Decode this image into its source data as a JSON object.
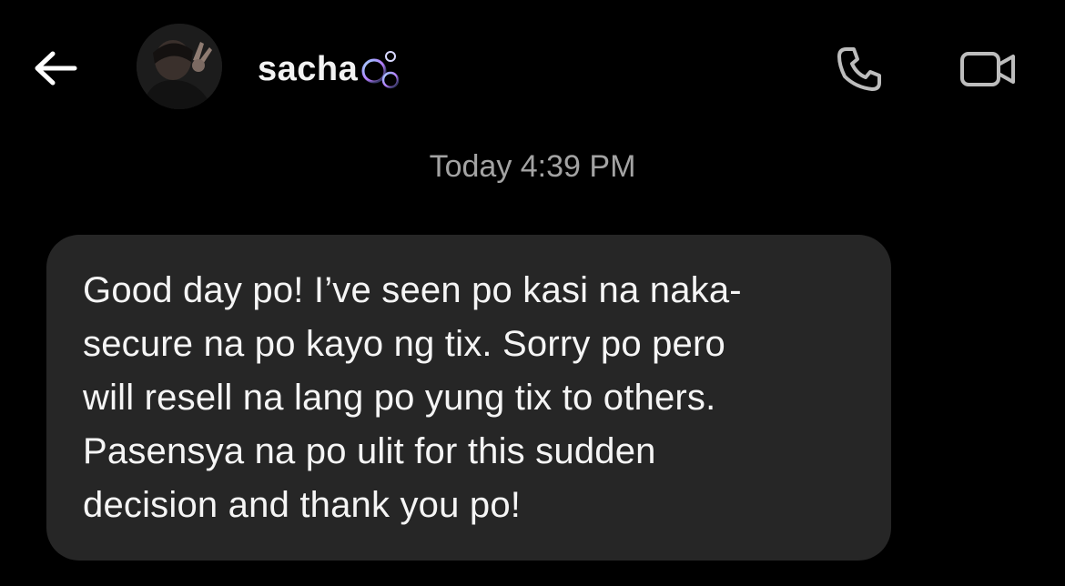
{
  "header": {
    "contact_name": "sacha",
    "back_icon": "arrow-left-icon",
    "call_icon": "phone-icon",
    "video_icon": "video-camera-icon",
    "name_decoration_icon": "bubbles-icon"
  },
  "thread": {
    "timestamp": "Today 4:39 PM",
    "messages": [
      {
        "text": "Good day po! I’ve seen po kasi na naka-\nsecure na po kayo ng tix. Sorry po pero\nwill resell na lang po yung tix to others.\nPasensya na po ulit for this sudden\ndecision and thank you po!"
      }
    ]
  },
  "colors": {
    "background": "#000000",
    "bubble": "#262626",
    "timestamp": "#a3a3a3",
    "icon": "#bdbdbd"
  }
}
